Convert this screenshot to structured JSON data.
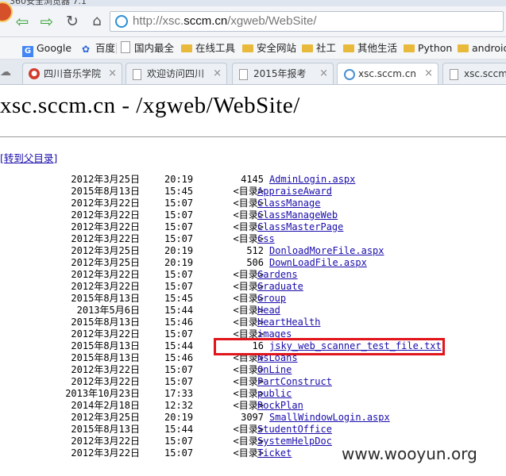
{
  "browser": {
    "window_title": "360安全浏览器 7.1",
    "address": {
      "url_prefix": "http://xsc.",
      "url_domain": "sccm.cn",
      "url_path": "/xgweb/WebSite/"
    },
    "bookmarks": [
      {
        "label": "Google",
        "icon": "google-icon"
      },
      {
        "label": "百度",
        "icon": "baidu-paw-icon"
      },
      {
        "label": "国内最全",
        "icon": "page-icon"
      },
      {
        "label": "在线工具",
        "icon": "folder-icon"
      },
      {
        "label": "安全网站",
        "icon": "folder-icon"
      },
      {
        "label": "社工",
        "icon": "folder-icon"
      },
      {
        "label": "其他生活",
        "icon": "folder-icon"
      },
      {
        "label": "Python",
        "icon": "folder-icon"
      },
      {
        "label": "android",
        "icon": "folder-icon"
      }
    ],
    "tabs": [
      {
        "label": "四川音乐学院",
        "icon": "school-logo-icon"
      },
      {
        "label": "欢迎访问四川",
        "icon": "page-icon"
      },
      {
        "label": "2015年报考",
        "icon": "page-icon"
      },
      {
        "label": "xsc.sccm.cn",
        "icon": "globe-icon"
      },
      {
        "label": "xsc.sccm",
        "icon": "page-icon"
      }
    ],
    "close_glyph": "×"
  },
  "page": {
    "title": "xsc.sccm.cn - /xgweb/WebSite/",
    "parent_link": "[转到父目录]",
    "entries": [
      {
        "date": "2012年3月25日",
        "time": "20:19",
        "size": "4145",
        "name": "AdminLogin.aspx"
      },
      {
        "date": "2015年8月13日",
        "time": "15:45",
        "size": "<目录>",
        "name": "AppraiseAward"
      },
      {
        "date": "2012年3月22日",
        "time": "15:07",
        "size": "<目录>",
        "name": "ClassManage"
      },
      {
        "date": "2012年3月22日",
        "time": "15:07",
        "size": "<目录>",
        "name": "ClassManageWeb"
      },
      {
        "date": "2012年3月22日",
        "time": "15:07",
        "size": "<目录>",
        "name": "ClassMasterPage"
      },
      {
        "date": "2012年3月22日",
        "time": "15:07",
        "size": "<目录>",
        "name": "Css"
      },
      {
        "date": "2012年3月25日",
        "time": "20:19",
        "size": "512",
        "name": "DonloadMoreFile.aspx"
      },
      {
        "date": "2012年3月25日",
        "time": "20:19",
        "size": "506",
        "name": "DownLoadFile.aspx"
      },
      {
        "date": "2012年3月22日",
        "time": "15:07",
        "size": "<目录>",
        "name": "Gardens"
      },
      {
        "date": "2012年3月22日",
        "time": "15:07",
        "size": "<目录>",
        "name": "Graduate"
      },
      {
        "date": "2015年8月13日",
        "time": "15:45",
        "size": "<目录>",
        "name": "Group"
      },
      {
        "date": "2013年5月6日",
        "time": "15:44",
        "size": "<目录>",
        "name": "Head"
      },
      {
        "date": "2015年8月13日",
        "time": "15:46",
        "size": "<目录>",
        "name": "HeartHealth"
      },
      {
        "date": "2012年3月22日",
        "time": "15:07",
        "size": "<目录>",
        "name": "images"
      },
      {
        "date": "2015年8月13日",
        "time": "15:44",
        "size": "16",
        "name": "jsky_web_scanner_test_file.txt"
      },
      {
        "date": "2015年8月13日",
        "time": "15:46",
        "size": "<目录>",
        "name": "NsLoans"
      },
      {
        "date": "2012年3月22日",
        "time": "15:07",
        "size": "<目录>",
        "name": "OnLine"
      },
      {
        "date": "2012年3月22日",
        "time": "15:07",
        "size": "<目录>",
        "name": "PartConstruct"
      },
      {
        "date": "2013年10月23日",
        "time": "17:33",
        "size": "<目录>",
        "name": "public"
      },
      {
        "date": "2014年2月18日",
        "time": "12:32",
        "size": "<目录>",
        "name": "RockPlan"
      },
      {
        "date": "2012年3月25日",
        "time": "20:19",
        "size": "3097",
        "name": "SmallWindowLogin.aspx"
      },
      {
        "date": "2015年8月13日",
        "time": "15:44",
        "size": "<目录>",
        "name": "StudentOffice"
      },
      {
        "date": "2012年3月22日",
        "time": "15:07",
        "size": "<目录>",
        "name": "SystemHelpDoc"
      },
      {
        "date": "2012年3月22日",
        "time": "15:07",
        "size": "<目录>",
        "name": "Ticket"
      }
    ]
  },
  "overlay": {
    "watermark": "www.wooyun.org",
    "highlight_color": "#e0161c"
  },
  "colors": {
    "link": "#1a0dab",
    "nav_arrow": "#3aa33a"
  }
}
